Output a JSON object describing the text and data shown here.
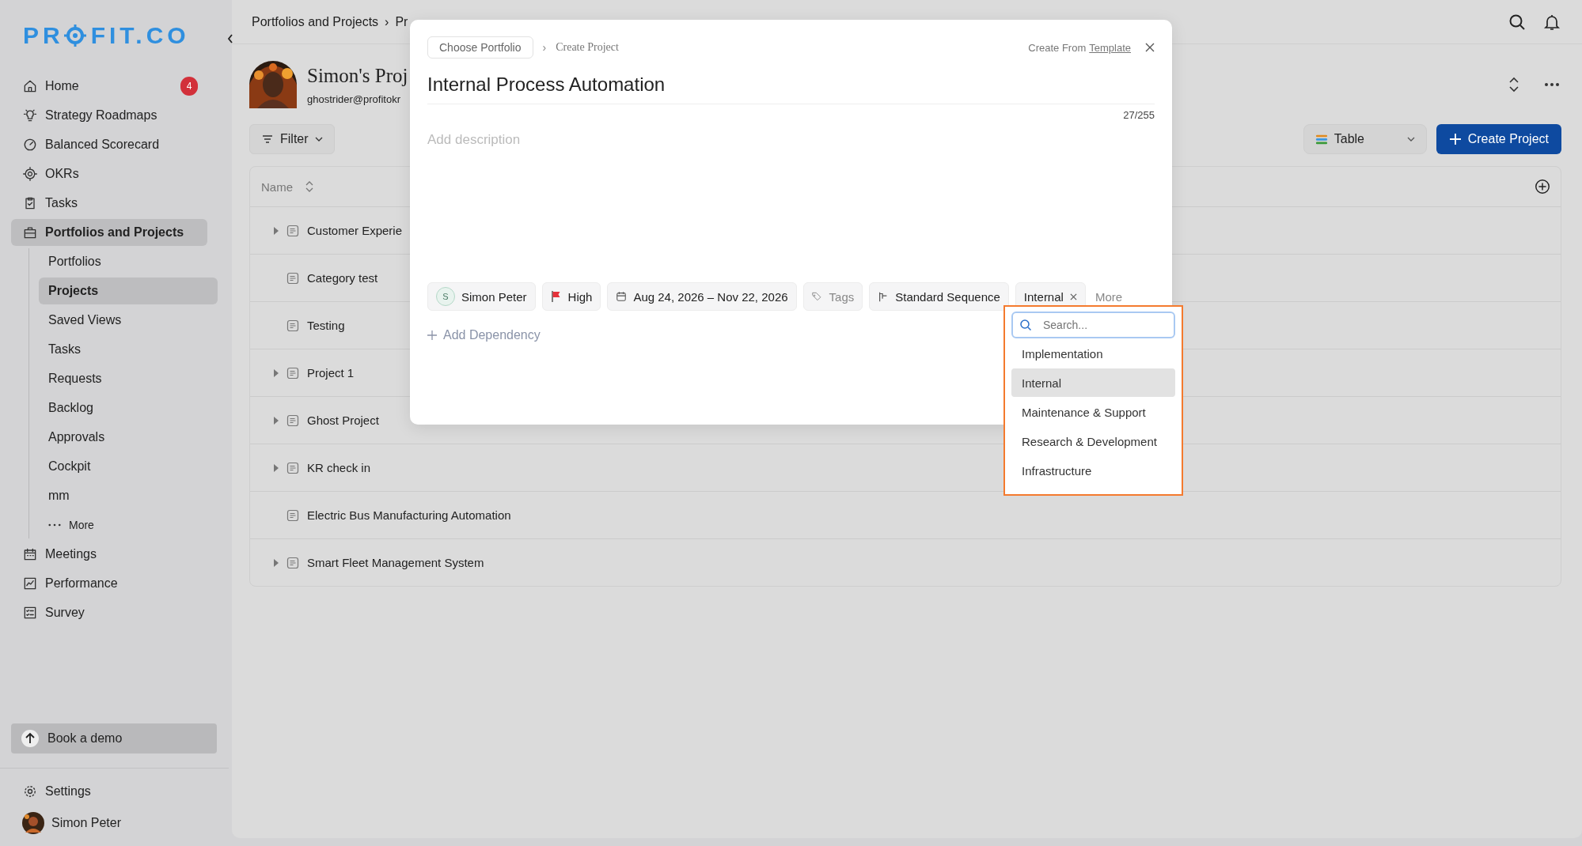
{
  "sidebar": {
    "logo_parts": [
      "PR",
      "FIT.CO"
    ],
    "items": [
      {
        "label": "Home",
        "badge": "4",
        "selected": false
      },
      {
        "label": "Strategy Roadmaps",
        "selected": false
      },
      {
        "label": "Balanced Scorecard",
        "selected": false
      },
      {
        "label": "OKRs",
        "selected": false
      },
      {
        "label": "Tasks",
        "selected": false
      },
      {
        "label": "Portfolios and Projects",
        "selected": true,
        "expanded": true,
        "children": [
          {
            "kind": "item",
            "label": "Portfolios",
            "selected": false
          },
          {
            "kind": "item",
            "label": "Projects",
            "selected": true
          },
          {
            "kind": "item",
            "label": "Saved Views",
            "selected": false
          },
          {
            "kind": "item",
            "label": "Tasks",
            "selected": false
          },
          {
            "kind": "item",
            "label": "Requests",
            "selected": false
          },
          {
            "kind": "item",
            "label": "Backlog",
            "selected": false
          },
          {
            "kind": "item",
            "label": "Approvals",
            "selected": false
          },
          {
            "kind": "item",
            "label": "Cockpit",
            "selected": false
          },
          {
            "kind": "item",
            "label": "mm",
            "selected": false
          },
          {
            "kind": "more",
            "label": "More",
            "selected": false
          }
        ]
      },
      {
        "label": "Meetings",
        "selected": false
      },
      {
        "label": "Performance",
        "selected": false
      },
      {
        "label": "Survey",
        "selected": false
      }
    ],
    "book_demo": "Book a demo",
    "settings": "Settings",
    "user": "Simon Peter"
  },
  "topbar": {
    "breadcrumb": [
      "Portfolios and Projects",
      "Pr"
    ],
    "separator": "›"
  },
  "page": {
    "title": "Simon's Proj",
    "email": "ghostrider@profitokr",
    "filter": "Filter",
    "view": "Table",
    "create": "Create Project",
    "table": {
      "columns": [
        "Name"
      ],
      "rows": [
        {
          "name": "Customer Experie",
          "expandable": true
        },
        {
          "name": "Category test",
          "expandable": false
        },
        {
          "name": "Testing",
          "expandable": false
        },
        {
          "name": "Project 1",
          "expandable": true
        },
        {
          "name": "Ghost Project",
          "expandable": true
        },
        {
          "name": "KR check in",
          "expandable": true
        },
        {
          "name": "Electric Bus Manufacturing Automation",
          "expandable": false
        },
        {
          "name": "Smart Fleet Management System",
          "expandable": true
        }
      ]
    }
  },
  "modal": {
    "breadcrumb": [
      "Choose Portfolio",
      "Create Project"
    ],
    "separator": "›",
    "create_from": "Create From",
    "template_link": "Template",
    "title": "Internal Process Automation",
    "counter": "27/255",
    "description_placeholder": "Add description",
    "chips": [
      {
        "kind": "assignee",
        "initial": "S",
        "label": "Simon Peter"
      },
      {
        "kind": "priority",
        "label": "High",
        "color": "#e5323b"
      },
      {
        "kind": "dates",
        "label": "Aug 24, 2026 – Nov 22, 2026"
      },
      {
        "kind": "tags",
        "label": "Tags"
      },
      {
        "kind": "sequence",
        "label": "Standard Sequence"
      },
      {
        "kind": "category",
        "label": "Internal"
      }
    ],
    "more": "More",
    "add_dependency": "Add Dependency",
    "dropdown": {
      "placeholder": "Search...",
      "options": [
        {
          "label": "Implementation",
          "selected": false
        },
        {
          "label": "Internal",
          "selected": true
        },
        {
          "label": "Maintenance & Support",
          "selected": false
        },
        {
          "label": "Research & Development",
          "selected": false
        },
        {
          "label": "Infrastructure",
          "selected": false
        }
      ]
    }
  }
}
